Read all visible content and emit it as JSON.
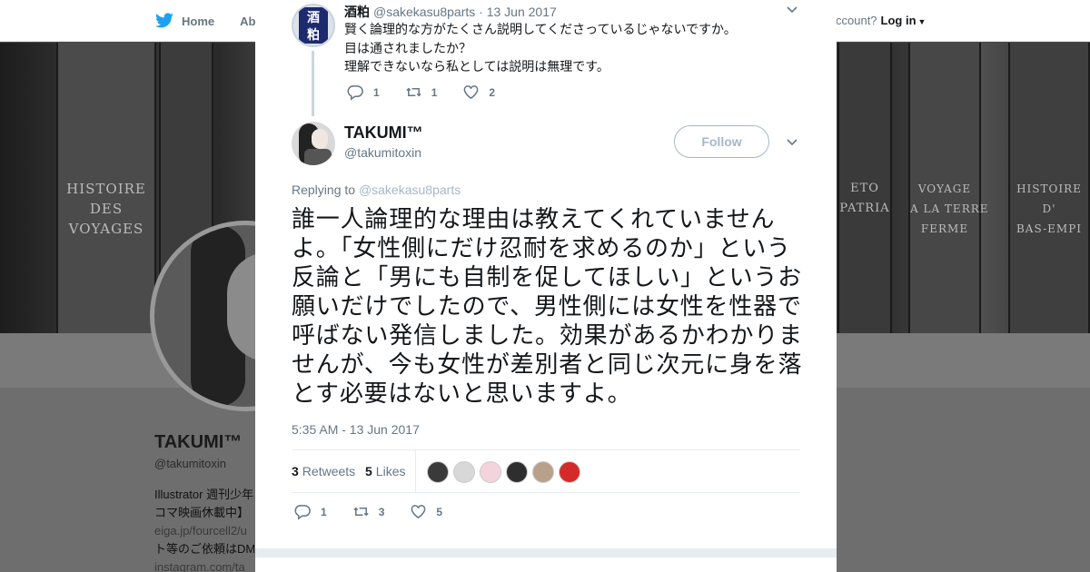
{
  "background": {
    "nav": {
      "home": "Home",
      "about": "Abo",
      "account_prompt": "ccount?",
      "login": "Log in"
    },
    "banner_books": [
      {
        "text": "HISTOIRE\nDES\nVOYAGES"
      },
      {
        "text": "ETO\nPATRIA"
      },
      {
        "text": "VOYAGE\nA LA TERRE\nFERME"
      },
      {
        "text": "HISTOIRE\nD'\nBAS-EMPI"
      }
    ],
    "profile": {
      "name": "TAKUMI™",
      "handle": "@takumitoxin",
      "bio_line1": "Illustrator 週刊少年",
      "bio_line2": "コマ映画休載中】",
      "bio_link1": "eiga.jp/fourcell2/u",
      "bio_line3": "ト等のご依頼はDM",
      "bio_link2": "instagram.com/ta"
    }
  },
  "modal": {
    "parent_tweet": {
      "avatar_chars": [
        "酒",
        "粕"
      ],
      "name": "酒粕",
      "handle": "@sakekasu8parts",
      "date": "· 13 Jun 2017",
      "lines": [
        "賢く論理的な方がたくさん説明してくださっているじゃないですか。",
        "目は通されましたか？",
        "理解できないなら私としては説明は無理です。"
      ],
      "replies": "1",
      "retweets": "1",
      "likes": "2"
    },
    "main_tweet": {
      "name": "TAKUMI™",
      "handle": "@takumitoxin",
      "follow_label": "Follow",
      "replying_label": "Replying to",
      "replying_to": "@sakekasu8parts",
      "text": "誰一人論理的な理由は教えてくれていませんよ。「女性側にだけ忍耐を求めるのか」という反論と「男にも自制を促してほしい」というお願いだけでしたので、男性側には女性を性器で呼ばない発信しました。効果があるかわかりませんが、今も女性が差別者と同じ次元に身を落とす必要はないと思いますよ。",
      "timestamp": "5:35 AM - 13 Jun 2017",
      "retweets_count": "3",
      "retweets_label": "Retweets",
      "likes_count": "5",
      "likes_label": "Likes",
      "liker_colors": [
        "#3a3a3a",
        "#d8d8d8",
        "#f3d3dc",
        "#2e2e2e",
        "#b8a08a",
        "#d42a2a"
      ],
      "action_replies": "1",
      "action_retweets": "3",
      "action_likes": "5"
    }
  },
  "colors": {
    "accent": "#1da1f2",
    "secondary_text": "#657786",
    "follow_border": "#a4b8c8"
  }
}
